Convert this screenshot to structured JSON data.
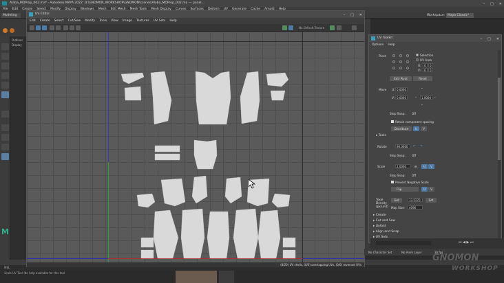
{
  "maya": {
    "title": "Aloba_MDProp_002.ma* - Autodesk MAYA 2022: D:\\GNOMON_WORKSHOP\\GNOMON\\scenes\\Aloba_MDProp_002.ma --- panel...",
    "menu": [
      "File",
      "Edit",
      "Create",
      "Select",
      "Modify",
      "Display",
      "Windows",
      "Mesh",
      "Edit Mesh",
      "Mesh Tools",
      "Mesh Display",
      "Curves",
      "Surfaces",
      "Deform",
      "UV",
      "Generate",
      "Cache",
      "Arnold",
      "Help"
    ],
    "mode": "Modeling",
    "workspace_label": "Workspace:",
    "workspace_value": "Maya Classic*",
    "outliner_labels": [
      "Outliner",
      "Display"
    ],
    "mel": "MEL",
    "help_text": "Scale UV Tool: No help available for this tool"
  },
  "uv_editor": {
    "title": "UV Editor",
    "menu": [
      "Edit",
      "Create",
      "Select",
      "Cut/Sew",
      "Modify",
      "Tools",
      "View",
      "Image",
      "Textures",
      "UV Sets",
      "Help"
    ],
    "no_texture": "No Default Texture",
    "status": "(8/20) UV shells, (0/0) overlapping UVs, (0/0) reversed UVs"
  },
  "uv_toolkit": {
    "title": "UV Toolkit",
    "menu": [
      "Options",
      "Help"
    ],
    "pivot": {
      "label": "Pivot",
      "selection": "Selection",
      "uv_area": "UV Area",
      "u_label": "U:",
      "v_label": "V:",
      "u_value": "0",
      "v_value": "0",
      "edit_pivot": "Edit Pivot",
      "reset": "Reset"
    },
    "move": {
      "label": "Move",
      "u_label": "U:",
      "v_label": "V:",
      "u_value": "0.0000",
      "v_value": "0.0000",
      "step": "1.0000",
      "step_snap": "Step Snap:",
      "step_snap_value": "Off",
      "retain": "Retain component spacing",
      "distribute": "Distribute",
      "u_btn": "U",
      "v_btn": "V"
    },
    "tools_section": "Tools",
    "rotate": {
      "label": "Rotate",
      "value": "90.0000",
      "step_snap": "Step Snap:",
      "step_snap_value": "Off"
    },
    "scale": {
      "label": "Scale",
      "value": "2.0000",
      "u_btn": "U",
      "v_btn": "V",
      "step_snap": "Step Snap:",
      "step_snap_value": "Off",
      "prevent_negative": "Prevent Negative Scale",
      "flip": "Flip",
      "flip_u": "U",
      "flip_v": "V"
    },
    "texel": {
      "label": "Texel Density (px/unit)",
      "get": "Get",
      "value": "13.5270",
      "set": "Set",
      "map_size_label": "Map Size:",
      "map_size": "4096"
    },
    "sections": [
      "Create",
      "Cut and Sew",
      "Unfold",
      "Align and Snap",
      "Arrange and Layout",
      "UV Sets"
    ]
  },
  "timeline": {
    "no_char_set": "No Character Set",
    "no_anim_layer": "No Anim Layer",
    "fps": "30 fps"
  },
  "watermark": {
    "line1": "GNOMON",
    "line2": "WORKSHOP"
  },
  "colors": {
    "accent_blue": "#4d7aa6",
    "axis_green": "#2fa02f",
    "axis_red": "#b02f2f",
    "axis_blue": "#3a3ab0",
    "maya_teal": "#1c8e9a"
  }
}
